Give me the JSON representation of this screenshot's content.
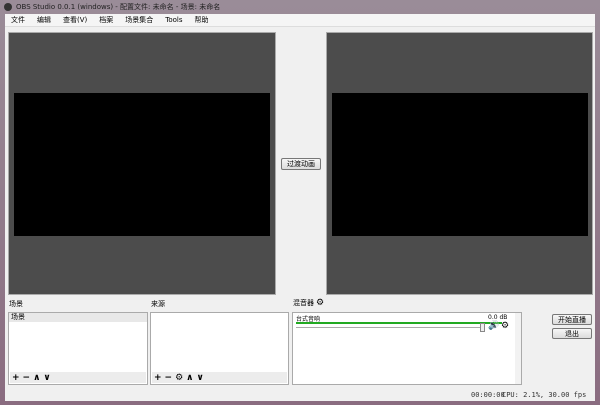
{
  "window": {
    "title": "OBS Studio 0.0.1 (windows) - 配置文件: 未命名 - 场景: 未命名"
  },
  "menu": [
    "文件",
    "编辑",
    "查看(V)",
    "档案",
    "场景集合",
    "Tools",
    "帮助"
  ],
  "transition_button": "过渡动画",
  "scenes": {
    "label": "场景",
    "items": [
      "场景"
    ]
  },
  "sources": {
    "label": "来源",
    "items": []
  },
  "mixer": {
    "label": "混音器",
    "channels": [
      {
        "name": "台式音响",
        "level": "0.0 dB",
        "volume": 0.95
      }
    ]
  },
  "buttons": {
    "start_stream": "开始直播",
    "exit": "退出"
  },
  "status": {
    "time": "00:00:00",
    "cpu": "CPU: 2.1%, 30.00 fps"
  },
  "colors": {
    "meter": "#22aa22",
    "preview_bg": "#4c4c4c"
  }
}
